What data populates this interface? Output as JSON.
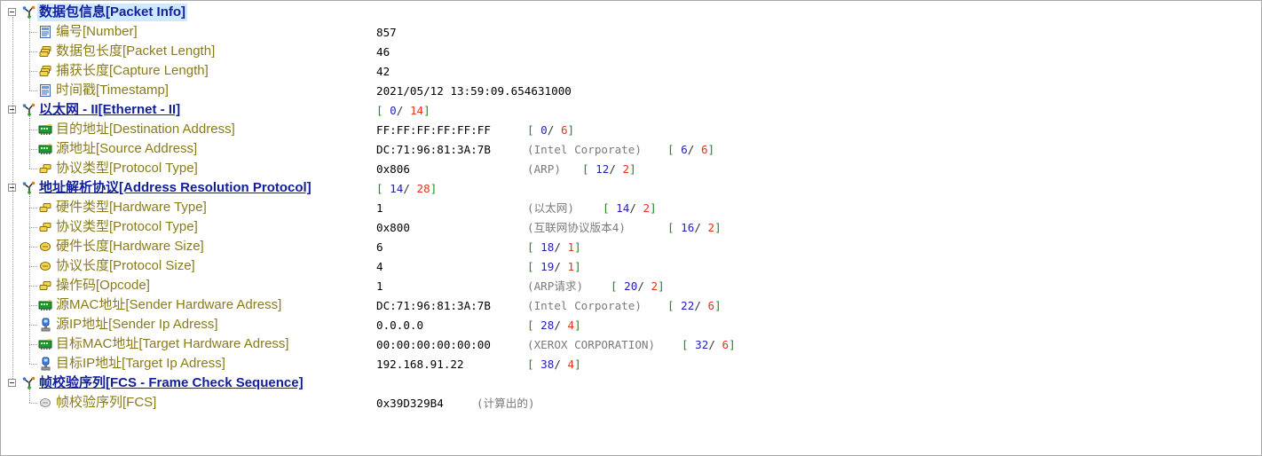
{
  "sections": [
    {
      "id": "packet-info",
      "title": "数据包信息[Packet Info]",
      "selected": true,
      "range": null,
      "fields": [
        {
          "id": "number",
          "icon": "doc-icon",
          "label": "编号[Number]",
          "value": "857",
          "note": "",
          "range": null
        },
        {
          "id": "packet-length",
          "icon": "bytes-icon",
          "label": "数据包长度[Packet Length]",
          "value": "46",
          "note": "",
          "range": null
        },
        {
          "id": "capture-length",
          "icon": "bytes-icon",
          "label": "捕获长度[Capture Length]",
          "value": "42",
          "note": "",
          "range": null
        },
        {
          "id": "timestamp",
          "icon": "doc-icon",
          "label": "时间戳[Timestamp]",
          "value": "2021/05/12 13:59:09.654631000",
          "note": "",
          "range": null
        }
      ]
    },
    {
      "id": "ethernet",
      "title": "以太网 - II[Ethernet - II]",
      "selected": false,
      "range": {
        "offset": "0",
        "length": "14"
      },
      "fields": [
        {
          "id": "destination-address",
          "icon": "mac-icon",
          "label": "目的地址[Destination Address]",
          "value": "FF:FF:FF:FF:FF:FF",
          "note": "",
          "range": {
            "offset": "0",
            "length": "6"
          }
        },
        {
          "id": "source-address",
          "icon": "mac-icon",
          "label": "源地址[Source Address]",
          "value": "DC:71:96:81:3A:7B",
          "note": "(Intel Corporate)",
          "range": {
            "offset": "6",
            "length": "6"
          }
        },
        {
          "id": "eth-protocol-type",
          "icon": "word-icon",
          "label": "协议类型[Protocol Type]",
          "value": "0x806",
          "note": "(ARP)",
          "range": {
            "offset": "12",
            "length": "2"
          }
        }
      ]
    },
    {
      "id": "arp",
      "title": "地址解析协议[Address Resolution Protocol]",
      "selected": false,
      "range": {
        "offset": "14",
        "length": "28"
      },
      "fields": [
        {
          "id": "hardware-type",
          "icon": "word-icon",
          "label": "硬件类型[Hardware Type]",
          "value": "1",
          "note": "(以太网)",
          "range": {
            "offset": "14",
            "length": "2"
          }
        },
        {
          "id": "arp-protocol-type",
          "icon": "word-icon",
          "label": "协议类型[Protocol Type]",
          "value": "0x800",
          "note": "(互联网协议版本4)",
          "range": {
            "offset": "16",
            "length": "2"
          }
        },
        {
          "id": "hardware-size",
          "icon": "byte-icon",
          "label": "硬件长度[Hardware Size]",
          "value": "6",
          "note": "",
          "range": {
            "offset": "18",
            "length": "1"
          }
        },
        {
          "id": "protocol-size",
          "icon": "byte-icon",
          "label": "协议长度[Protocol Size]",
          "value": "4",
          "note": "",
          "range": {
            "offset": "19",
            "length": "1"
          }
        },
        {
          "id": "opcode",
          "icon": "word-icon",
          "label": "操作码[Opcode]",
          "value": "1",
          "note": "(ARP请求)",
          "range": {
            "offset": "20",
            "length": "2"
          }
        },
        {
          "id": "sender-mac",
          "icon": "mac-icon",
          "label": "源MAC地址[Sender Hardware Adress]",
          "value": "DC:71:96:81:3A:7B",
          "note": "(Intel Corporate)",
          "range": {
            "offset": "22",
            "length": "6"
          }
        },
        {
          "id": "sender-ip",
          "icon": "ip-icon",
          "label": "源IP地址[Sender Ip Adress]",
          "value": "0.0.0.0",
          "note": "",
          "range": {
            "offset": "28",
            "length": "4"
          }
        },
        {
          "id": "target-mac",
          "icon": "mac-icon",
          "label": "目标MAC地址[Target Hardware Adress]",
          "value": "00:00:00:00:00:00",
          "note": "(XEROX CORPORATION)",
          "range": {
            "offset": "32",
            "length": "6"
          }
        },
        {
          "id": "target-ip",
          "icon": "ip-icon",
          "label": "目标IP地址[Target Ip Adress]",
          "value": "192.168.91.22",
          "note": "",
          "range": {
            "offset": "38",
            "length": "4"
          }
        }
      ]
    },
    {
      "id": "fcs",
      "title": "帧校验序列[FCS - Frame Check Sequence]",
      "selected": false,
      "range": null,
      "fields": [
        {
          "id": "fcs",
          "icon": "gray-byte-icon",
          "label": "帧校验序列[FCS]",
          "value": "0x39D329B4",
          "note": "(计算出的)",
          "range": null
        }
      ]
    }
  ],
  "colors": {
    "section_title": "#13209c",
    "field_label": "#8a7b1a",
    "selection_bg": "#cde8ff",
    "range_bracket": "#1d8a1d",
    "range_offset": "#1f1fb4",
    "range_length": "#e0361d",
    "note": "#7a7a7a"
  }
}
